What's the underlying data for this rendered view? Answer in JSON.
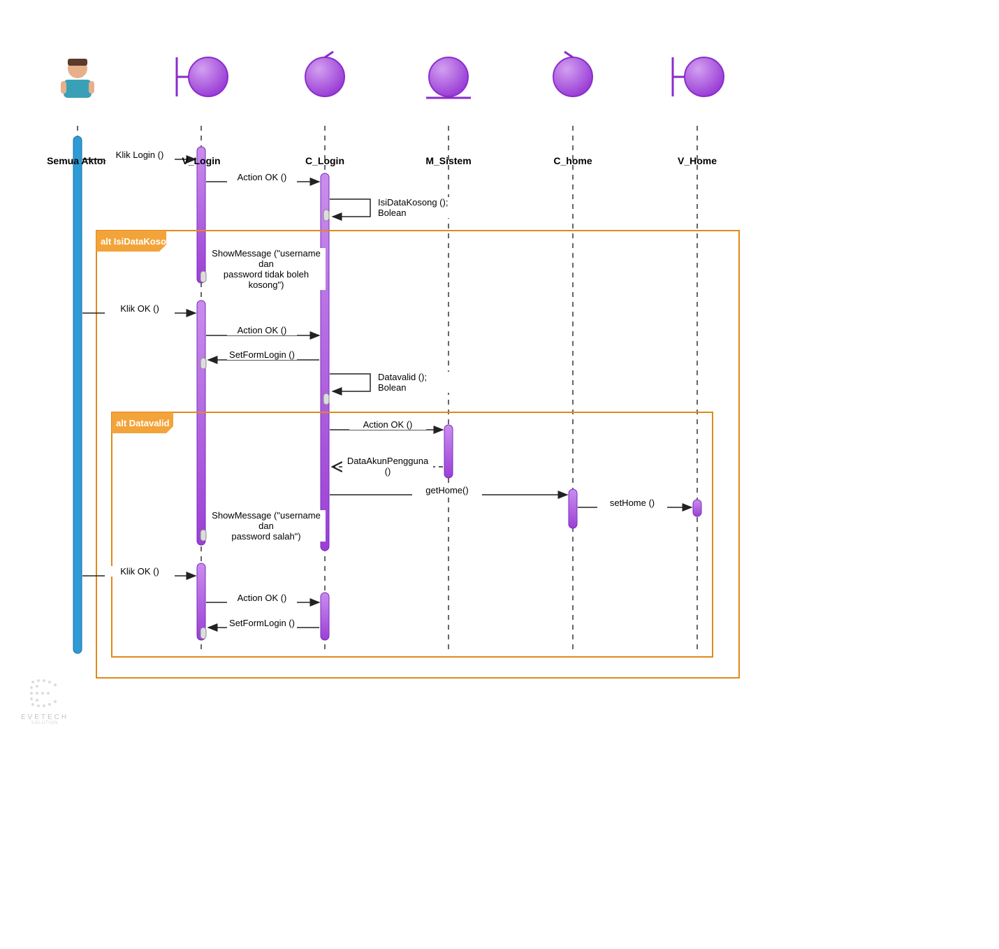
{
  "participants": {
    "actor": "Semua Aktor",
    "v_login": "V_Login",
    "c_login": "C_Login",
    "m_sistem": "M_Sistem",
    "c_home": "C_home",
    "v_home": "V_Home"
  },
  "alt_frames": {
    "isidatakosong": "alt IsiDataKosong",
    "datavalid": "alt Datavalid"
  },
  "messages": {
    "klik_login": "Klik Login ()",
    "action_ok_1": "Action OK ()",
    "isidatakosong_self": "IsiDataKosong ();\nBolean",
    "show_msg_empty": "ShowMessage (\"username dan\npassword tidak boleh kosong\")",
    "klik_ok_1": "Klik OK ()",
    "action_ok_2": "Action OK ()",
    "setformlogin_1": "SetFormLogin ()",
    "datavalid_self": "Datavalid ();\nBolean",
    "action_ok_3": "Action OK ()",
    "dataakun": "DataAkunPengguna ()",
    "gethome": "getHome()",
    "sethome": "setHome ()",
    "show_msg_wrong": "ShowMessage (\"username dan\npassword salah\")",
    "klik_ok_2": "Klik OK ()",
    "action_ok_4": "Action OK ()",
    "setformlogin_2": "SetFormLogin ()"
  },
  "logo": {
    "line1": "EVETECH",
    "line2": "SOLUTION"
  },
  "colors": {
    "actor_blue": "#2e9bd6",
    "purple_light": "#c98eec",
    "purple_dark": "#9b3fd6",
    "orange": "#e08a1a",
    "orange_light": "#f2a43a"
  }
}
